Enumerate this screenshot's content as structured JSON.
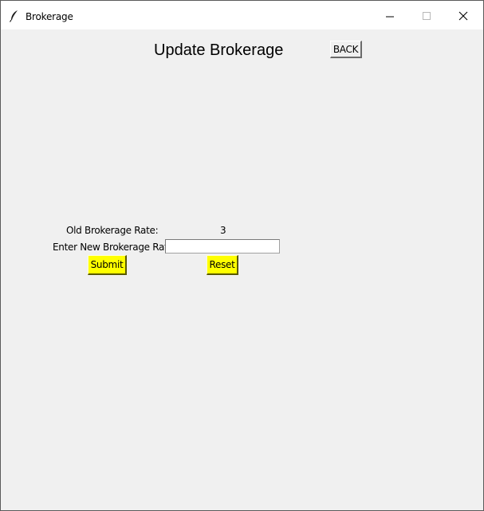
{
  "window": {
    "title": "Brokerage",
    "app_icon": "feather-icon",
    "controls": [
      "minimize-icon",
      "maximize-icon",
      "close-icon"
    ]
  },
  "header": {
    "title": "Update Brokerage",
    "back_label": "BACK"
  },
  "form": {
    "old_rate_label": "Old Brokerage Rate:",
    "old_rate_value": "3",
    "new_rate_label": "Enter New Brokerage Rate:",
    "new_rate_value": "",
    "submit_label": "Submit",
    "reset_label": "Reset"
  },
  "colors": {
    "background": "#f0f0f0",
    "button_yellow": "#ffff00",
    "titlebar": "#ffffff"
  }
}
